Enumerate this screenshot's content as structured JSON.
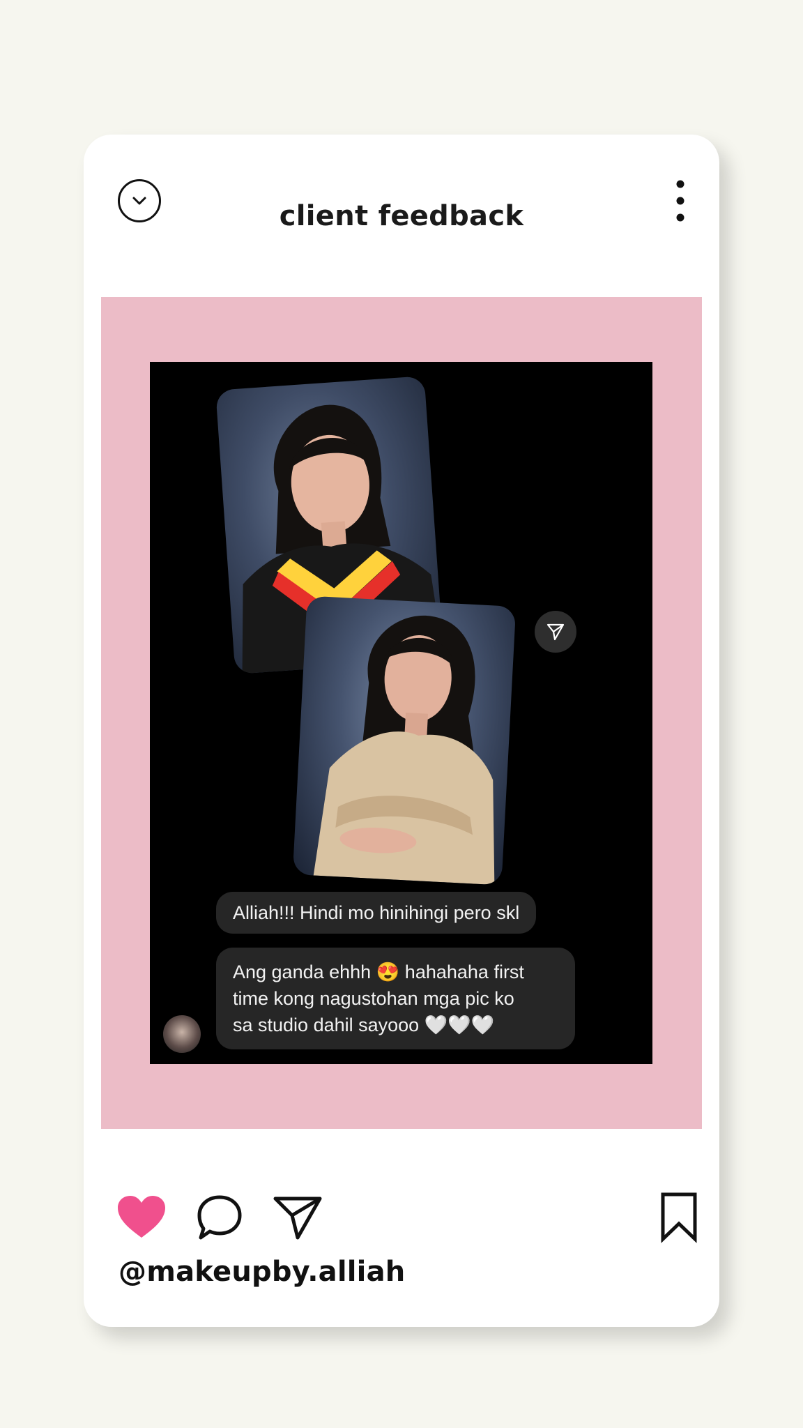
{
  "header": {
    "title": "client feedback",
    "back_icon": "chevron-down-icon",
    "menu_icon": "more-vertical-icon"
  },
  "post": {
    "background_color": "#ecbcc7",
    "messages": [
      {
        "text": "Alliah!!! Hindi mo hinihingi pero skl"
      },
      {
        "lines": [
          "Ang ganda ehhh 😍 hahahaha first",
          "time kong nagustohan mga pic ko",
          "sa studio dahil sayooo 🤍🤍🤍"
        ]
      }
    ]
  },
  "actions": {
    "like_icon": "heart-icon",
    "like_color": "#f0508d",
    "comment_icon": "comment-icon",
    "share_icon": "send-icon",
    "save_icon": "bookmark-icon"
  },
  "footer": {
    "username": "@makeupby.alliah"
  }
}
